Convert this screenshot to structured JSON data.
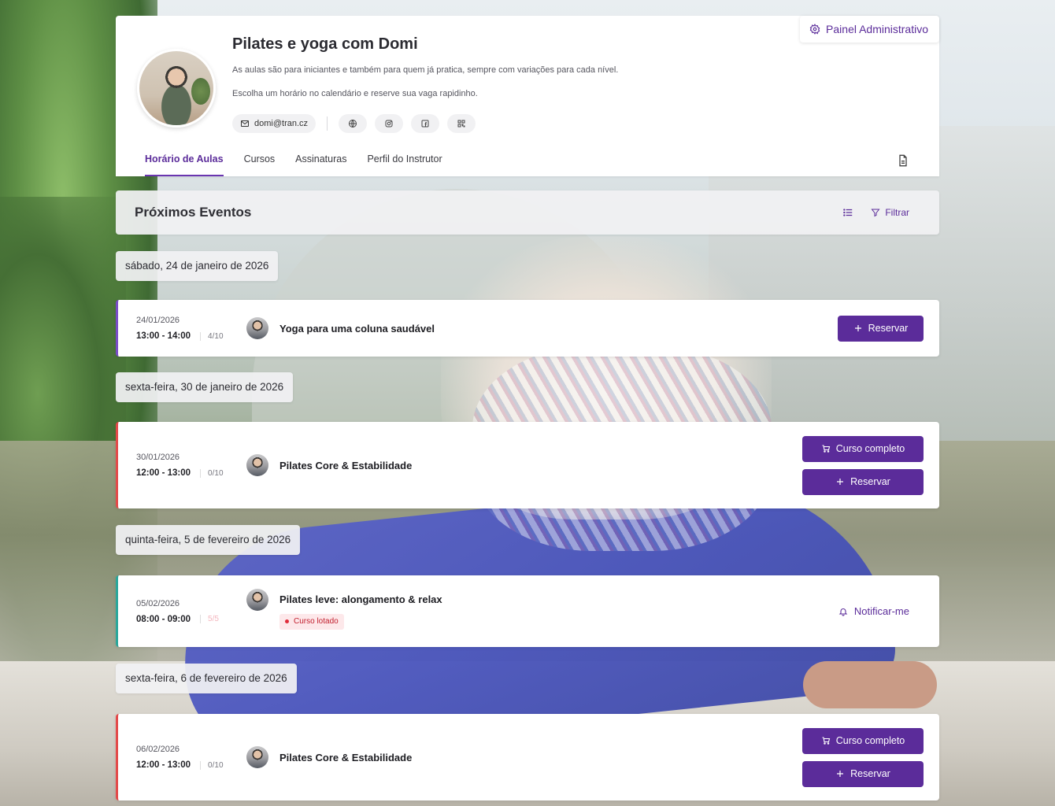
{
  "profile": {
    "title": "Pilates e yoga com Domi",
    "description": "As aulas são para iniciantes e também para quem já pratica, sempre com variações para cada nível.",
    "description2": "Escolha um horário no calendário e reserve sua vaga rapidinho.",
    "email": "domi@tran.cz",
    "admin_label": "Painel Administrativo",
    "icons": [
      "globe-icon",
      "instagram-icon",
      "facebook-icon",
      "qr-code-icon"
    ]
  },
  "tabs": [
    {
      "label": "Horário de Aulas",
      "active": true
    },
    {
      "label": "Cursos",
      "active": false
    },
    {
      "label": "Assinaturas",
      "active": false
    },
    {
      "label": "Perfil do Instrutor",
      "active": false
    }
  ],
  "events_header": {
    "title": "Próximos Eventos",
    "filter_label": "Filtrar"
  },
  "days": [
    {
      "label": "sábado, 24 de janeiro de 2026",
      "event": {
        "date": "24/01/2026",
        "hours": "13:00 - 14:00",
        "seats": "4/10",
        "title": "Yoga para uma coluna saudável",
        "accent": "#7a4dc7"
      }
    },
    {
      "label": "sexta-feira, 30 de janeiro de 2026",
      "event": {
        "date": "30/01/2026",
        "hours": "12:00 - 13:00",
        "seats": "0/10",
        "title": "Pilates Core & Estabilidade",
        "accent": "#e34a4a"
      }
    },
    {
      "label": "quinta-feira, 5 de fevereiro de 2026",
      "event": {
        "date": "05/02/2026",
        "hours": "08:00 - 09:00",
        "seats": "5/5",
        "title": "Pilates leve: alongamento & relax",
        "badge": "Curso lotado",
        "accent": "#2aa79b"
      }
    },
    {
      "label": "sexta-feira, 6 de fevereiro de 2026",
      "event": {
        "date": "06/02/2026",
        "hours": "12:00 - 13:00",
        "seats": "0/10",
        "title": "Pilates Core & Estabilidade",
        "accent": "#e34a4a"
      }
    }
  ],
  "buttons": {
    "reserve": "Reservar",
    "full_course": "Curso completo",
    "notify": "Notificar-me"
  },
  "colors": {
    "accent": "#5b2c9a",
    "full_badge": "#c2202f"
  }
}
